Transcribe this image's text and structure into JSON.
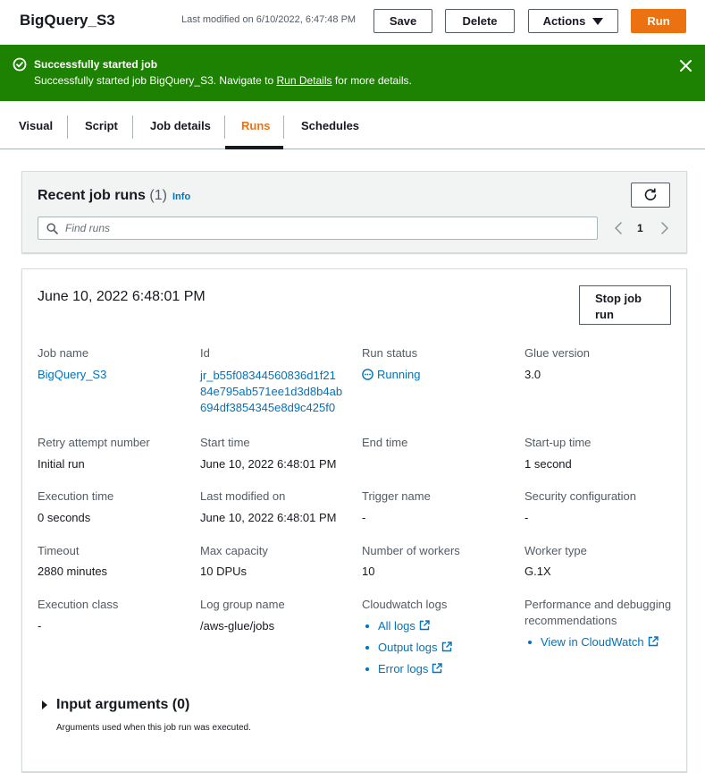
{
  "header": {
    "title": "BigQuery_S3",
    "last_modified": "Last modified on 6/10/2022, 6:47:48 PM",
    "save_label": "Save",
    "delete_label": "Delete",
    "actions_label": "Actions",
    "run_label": "Run"
  },
  "flash": {
    "title": "Successfully started job",
    "body_prefix": "Successfully started job BigQuery_S3. Navigate to ",
    "link": "Run Details",
    "body_suffix": " for more details.",
    "color": "#1d8102"
  },
  "tabs": [
    {
      "label": "Visual"
    },
    {
      "label": "Script"
    },
    {
      "label": "Job details"
    },
    {
      "label": "Runs",
      "active": true
    },
    {
      "label": "Schedules"
    }
  ],
  "recent_runs": {
    "title": "Recent job runs",
    "count": "(1)",
    "info": "Info",
    "search_placeholder": "Find runs",
    "page": "1"
  },
  "run": {
    "date": "June 10, 2022 6:48:01 PM",
    "stop_label_line1": "Stop job",
    "stop_label_line2": "run",
    "fields": {
      "job_name_label": "Job name",
      "job_name": "BigQuery_S3",
      "id_label": "Id",
      "id_line1": "jr_b55f08344560836d1f21",
      "id_line2": "84e795ab571ee1d3d8b4ab",
      "id_line3": "694df3854345e8d9c425f0",
      "run_status_label": "Run status",
      "run_status": "Running",
      "glue_version_label": "Glue version",
      "glue_version": "3.0",
      "retry_label": "Retry attempt number",
      "retry": "Initial run",
      "start_time_label": "Start time",
      "start_time": "June 10, 2022 6:48:01 PM",
      "end_time_label": "End time",
      "end_time": "",
      "startup_time_label": "Start-up time",
      "startup_time": "1 second",
      "execution_time_label": "Execution time",
      "execution_time": "0 seconds",
      "last_modified_label": "Last modified on",
      "last_modified": "June 10, 2022 6:48:01 PM",
      "trigger_name_label": "Trigger name",
      "trigger_name": "-",
      "security_config_label": "Security configuration",
      "security_config": "-",
      "timeout_label": "Timeout",
      "timeout": "2880 minutes",
      "max_capacity_label": "Max capacity",
      "max_capacity": "10 DPUs",
      "num_workers_label": "Number of workers",
      "num_workers": "10",
      "worker_type_label": "Worker type",
      "worker_type": "G.1X",
      "execution_class_label": "Execution class",
      "execution_class": "-",
      "log_group_label": "Log group name",
      "log_group": "/aws-glue/jobs",
      "cloudwatch_label": "Cloudwatch logs",
      "cloudwatch_logs": [
        "All logs",
        "Output logs",
        "Error logs"
      ],
      "perf_label_line1": "Performance and debugging",
      "perf_label_line2": "recommendations",
      "perf_link": "View in CloudWatch"
    },
    "input_args_title": "Input arguments (0)",
    "input_args_desc": "Arguments used when this job run was executed."
  }
}
